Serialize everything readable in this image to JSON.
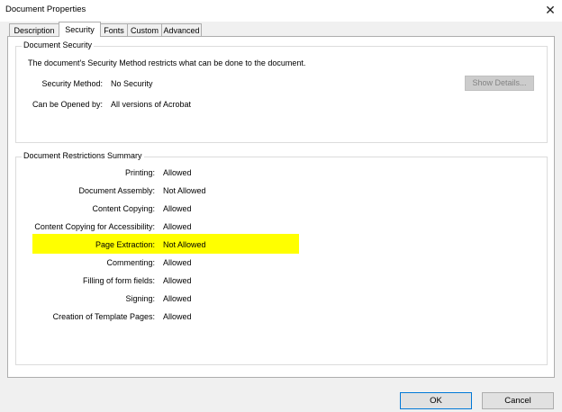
{
  "window": {
    "title": "Document Properties",
    "close_glyph": "✕"
  },
  "tabs": [
    {
      "label": "Description",
      "active": false
    },
    {
      "label": "Security",
      "active": true
    },
    {
      "label": "Fonts",
      "active": false
    },
    {
      "label": "Custom",
      "active": false
    },
    {
      "label": "Advanced",
      "active": false
    }
  ],
  "security_group": {
    "legend": "Document Security",
    "description": "The document's Security Method restricts what can be done to the document.",
    "method_label": "Security Method:",
    "method_value": "No Security",
    "show_details_label": "Show Details...",
    "opened_by_label": "Can be Opened by:",
    "opened_by_value": "All versions of Acrobat"
  },
  "restrictions_group": {
    "legend": "Document Restrictions Summary",
    "rows": [
      {
        "label": "Printing:",
        "value": "Allowed"
      },
      {
        "label": "Document Assembly:",
        "value": "Not Allowed"
      },
      {
        "label": "Content Copying:",
        "value": "Allowed"
      },
      {
        "label": "Content Copying for Accessibility:",
        "value": "Allowed"
      },
      {
        "label": "Page Extraction:",
        "value": "Not Allowed",
        "highlighted": true,
        "highlight_color": "#ffff00"
      },
      {
        "label": "Commenting:",
        "value": "Allowed"
      },
      {
        "label": "Filling of form fields:",
        "value": "Allowed"
      },
      {
        "label": "Signing:",
        "value": "Allowed"
      },
      {
        "label": "Creation of Template Pages:",
        "value": "Allowed"
      }
    ]
  },
  "buttons": {
    "ok": "OK",
    "cancel": "Cancel"
  }
}
